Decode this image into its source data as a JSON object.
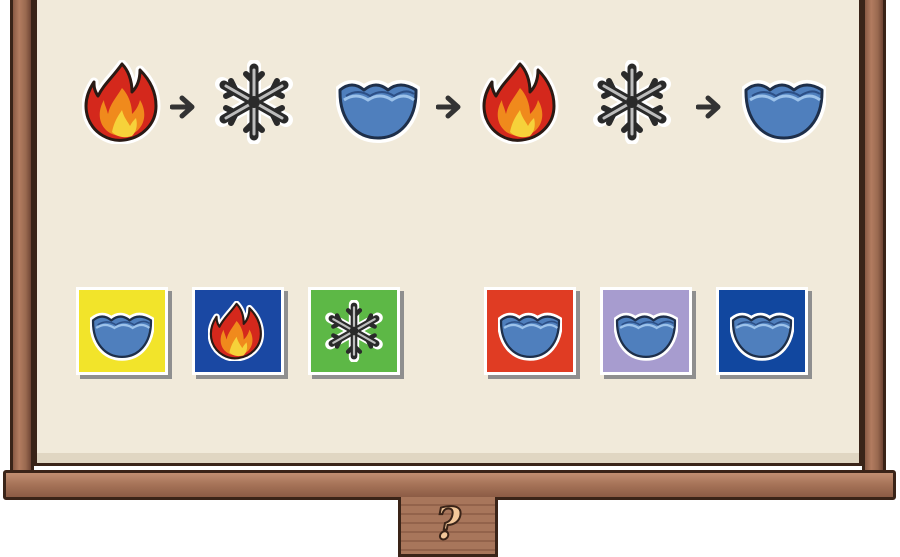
{
  "board": {
    "help_button_label": "?"
  },
  "sequence": [
    {
      "icon": "fire-icon"
    },
    {
      "icon": "snowflake-icon"
    },
    {
      "icon": "water-icon"
    },
    {
      "icon": "fire-icon"
    },
    {
      "icon": "snowflake-icon"
    },
    {
      "icon": "water-icon"
    }
  ],
  "choices_left": [
    {
      "icon": "water-icon",
      "bg_color": "#f2e42a"
    },
    {
      "icon": "fire-icon",
      "bg_color": "#1a48a3"
    },
    {
      "icon": "snowflake-icon",
      "bg_color": "#5db846"
    }
  ],
  "choices_right": [
    {
      "icon": "water-icon",
      "bg_color": "#e03c23"
    },
    {
      "icon": "water-icon",
      "bg_color": "#a79ccf"
    },
    {
      "icon": "water-icon",
      "bg_color": "#11479f"
    }
  ],
  "colors": {
    "paper": "#f1eada",
    "frame_wood": "#a77459",
    "arrow": "#333333",
    "water_blue": "#4f7fbd",
    "fire_red": "#d4281c",
    "fire_orange": "#f08a1c",
    "fire_yellow": "#f6d23a"
  }
}
